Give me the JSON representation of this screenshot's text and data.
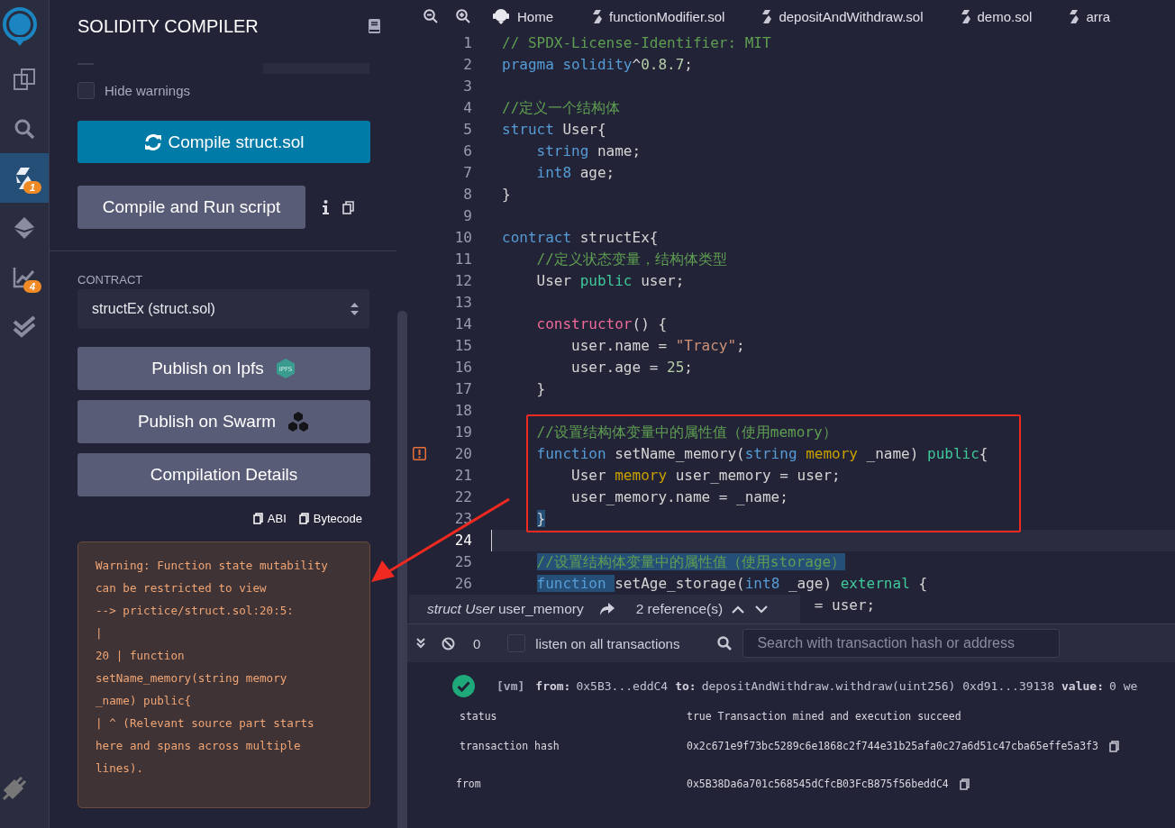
{
  "icon_bar": {
    "items": [
      {
        "kind": "logo",
        "selected": false
      },
      {
        "kind": "files",
        "selected": false
      },
      {
        "kind": "search",
        "selected": false
      },
      {
        "kind": "compiler",
        "selected": true,
        "badge": "1"
      },
      {
        "kind": "deploy",
        "selected": false
      },
      {
        "kind": "analysis",
        "selected": false,
        "badge": "4"
      },
      {
        "kind": "tests",
        "selected": false
      }
    ],
    "bottom_items": [
      {
        "kind": "plugins",
        "selected": false
      }
    ]
  },
  "panel": {
    "title": "SOLIDITY COMPILER",
    "hide_warnings": {
      "label": "Hide warnings",
      "checked": false
    },
    "compile_button": "Compile struct.sol",
    "run_button": "Compile and Run script",
    "contract": {
      "label": "CONTRACT",
      "value": "structEx (struct.sol)"
    },
    "actions": [
      {
        "label": "Publish on Ipfs",
        "kind": "ipfs",
        "badge": "IPFS"
      },
      {
        "label": "Publish on Swarm",
        "kind": "swarm"
      },
      {
        "label": "Compilation Details",
        "kind": "details"
      }
    ],
    "copy_links": [
      "ABI",
      "Bytecode"
    ],
    "warning": {
      "lines": [
        "Warning: Function state mutability",
        "can be restricted to view",
        "--> prictice/struct.sol:20:5:",
        "|",
        "20 | function",
        "setName_memory(string memory",
        "_name) public{",
        "| ^ (Relevant source part starts",
        "here and spans across multiple",
        "lines)."
      ]
    }
  },
  "editor": {
    "tabs": [
      {
        "label": "Home",
        "kind": "home"
      },
      {
        "label": "functionModifier.sol",
        "kind": "file"
      },
      {
        "label": "depositAndWithdraw.sol",
        "kind": "file"
      },
      {
        "label": "demo.sol",
        "kind": "file"
      },
      {
        "label": "arra",
        "kind": "file"
      }
    ],
    "lines": [
      {
        "number": "1",
        "active": false,
        "warning": false,
        "tokens": [
          {
            "kind": "comment",
            "t": "// SPDX-License-Identifier: MIT",
            "selected": false
          }
        ]
      },
      {
        "number": "2",
        "active": false,
        "warning": false,
        "tokens": [
          {
            "kind": "kw",
            "t": "pragma",
            "selected": false
          },
          {
            "kind": "kw",
            "t": " solidity",
            "selected": false
          },
          {
            "kind": "plain",
            "t": "^",
            "selected": false
          },
          {
            "kind": "num",
            "t": "0.8.7",
            "selected": false
          },
          {
            "kind": "plain",
            "t": ";",
            "selected": false
          }
        ]
      },
      {
        "number": "3",
        "active": false,
        "warning": false
      },
      {
        "number": "4",
        "active": false,
        "warning": false,
        "tokens": [
          {
            "kind": "comment",
            "t": "//定义一个结构体",
            "selected": false
          }
        ]
      },
      {
        "number": "5",
        "active": false,
        "warning": false,
        "tokens": [
          {
            "kind": "kw",
            "t": "struct",
            "selected": false
          },
          {
            "kind": "plain",
            "t": " User{",
            "selected": false
          }
        ]
      },
      {
        "number": "6",
        "active": false,
        "warning": false,
        "tokens": [
          {
            "kind": "kw",
            "t": "    string",
            "selected": false
          },
          {
            "kind": "plain",
            "t": " name;",
            "selected": false
          }
        ]
      },
      {
        "number": "7",
        "active": false,
        "warning": false,
        "tokens": [
          {
            "kind": "kw",
            "t": "    int8",
            "selected": false
          },
          {
            "kind": "plain",
            "t": " age;",
            "selected": false
          }
        ]
      },
      {
        "number": "8",
        "active": false,
        "warning": false,
        "tokens": [
          {
            "kind": "plain",
            "t": "}",
            "selected": false
          }
        ]
      },
      {
        "number": "9",
        "active": false,
        "warning": false
      },
      {
        "number": "10",
        "active": false,
        "warning": false,
        "tokens": [
          {
            "kind": "kw",
            "t": "contract",
            "selected": false
          },
          {
            "kind": "plain",
            "t": " structEx{",
            "selected": false
          }
        ]
      },
      {
        "number": "11",
        "active": false,
        "warning": false,
        "tokens": [
          {
            "kind": "comment",
            "t": "    //定义状态变量，结构体类型",
            "selected": false
          }
        ]
      },
      {
        "number": "12",
        "active": false,
        "warning": false,
        "tokens": [
          {
            "kind": "plain",
            "t": "    User ",
            "selected": false
          },
          {
            "kind": "mod",
            "t": "public",
            "selected": false
          },
          {
            "kind": "plain",
            "t": " user;",
            "selected": false
          }
        ]
      },
      {
        "number": "13",
        "active": false,
        "warning": false
      },
      {
        "number": "14",
        "active": false,
        "warning": false,
        "tokens": [
          {
            "kind": "ctor",
            "t": "    constructor",
            "selected": false
          },
          {
            "kind": "plain",
            "t": "() {",
            "selected": false
          }
        ]
      },
      {
        "number": "15",
        "active": false,
        "warning": false,
        "tokens": [
          {
            "kind": "plain",
            "t": "        user.name = ",
            "selected": false
          },
          {
            "kind": "str",
            "t": "\"Tracy\"",
            "selected": false
          },
          {
            "kind": "plain",
            "t": ";",
            "selected": false
          }
        ]
      },
      {
        "number": "16",
        "active": false,
        "warning": false,
        "tokens": [
          {
            "kind": "plain",
            "t": "        user.age = ",
            "selected": false
          },
          {
            "kind": "num",
            "t": "25",
            "selected": false
          },
          {
            "kind": "plain",
            "t": ";",
            "selected": false
          }
        ]
      },
      {
        "number": "17",
        "active": false,
        "warning": false,
        "tokens": [
          {
            "kind": "plain",
            "t": "    }",
            "selected": false
          }
        ]
      },
      {
        "number": "18",
        "active": false,
        "warning": false
      },
      {
        "number": "19",
        "active": false,
        "warning": false,
        "tokens": [
          {
            "kind": "comment",
            "t": "    //设置结构体变量中的属性值（使用memory）",
            "selected": false
          }
        ]
      },
      {
        "number": "20",
        "active": false,
        "warning": true,
        "tokens": [
          {
            "kind": "kw",
            "t": "    function",
            "selected": false
          },
          {
            "kind": "plain",
            "t": " setName_memory(",
            "selected": false
          },
          {
            "kind": "kw",
            "t": "string",
            "selected": false
          },
          {
            "kind": "loc",
            "t": " memory",
            "selected": false
          },
          {
            "kind": "plain",
            "t": " _name) ",
            "selected": false
          },
          {
            "kind": "mod",
            "t": "public",
            "selected": false
          },
          {
            "kind": "plain",
            "t": "{",
            "selected": false
          }
        ]
      },
      {
        "number": "21",
        "active": false,
        "warning": false,
        "tokens": [
          {
            "kind": "plain",
            "t": "        User ",
            "selected": false
          },
          {
            "kind": "loc",
            "t": "memory",
            "selected": false
          },
          {
            "kind": "plain",
            "t": " user_memory = user;",
            "selected": false
          }
        ]
      },
      {
        "number": "22",
        "active": false,
        "warning": false,
        "tokens": [
          {
            "kind": "plain",
            "t": "        user_memory.name = _name;",
            "selected": false
          }
        ]
      },
      {
        "number": "23",
        "active": false,
        "warning": false,
        "tokens": [
          {
            "kind": "plain",
            "t": "    }",
            "selected": true
          }
        ]
      },
      {
        "number": "24",
        "active": true,
        "warning": false
      },
      {
        "number": "25",
        "active": false,
        "warning": false,
        "tokens": [
          {
            "kind": "comment",
            "t": "    //设置结构体变量中的属性值（使用storage）",
            "selected": true
          }
        ]
      },
      {
        "number": "26",
        "active": false,
        "warning": false,
        "tokens": [
          {
            "kind": "kw",
            "t": "    function ",
            "selected": true
          },
          {
            "kind": "plain",
            "t": "setAge_storage(",
            "selected": false
          },
          {
            "kind": "kw",
            "t": "int8",
            "selected": false
          },
          {
            "kind": "plain",
            "t": " _age) ",
            "selected": false
          },
          {
            "kind": "mod",
            "t": "external",
            "selected": false
          },
          {
            "kind": "plain",
            "t": " {",
            "selected": false
          }
        ]
      },
      {
        "active": false,
        "warning": false,
        "tokens": [
          {
            "kind": "plain",
            "t": "                                    = user;",
            "selected": false
          }
        ]
      }
    ],
    "tooltip": {
      "type": "struct User",
      "name": "user_memory",
      "references": "2 reference(s)"
    }
  },
  "terminal": {
    "count": "0",
    "listen": {
      "label": "listen on all transactions",
      "checked": false
    },
    "search": {
      "placeholder": "Search with transaction hash or address"
    },
    "log": {
      "source": "[vm]",
      "parts": [
        {
          "key": "from:",
          "value": "0x5B3...eddC4"
        },
        {
          "key": "to:",
          "value": "depositAndWithdraw.withdraw(uint256) 0xd91...39138"
        },
        {
          "key": "value:",
          "value": "0 we"
        }
      ],
      "rows": [
        {
          "label": "status",
          "value": "true Transaction mined and execution succeed",
          "copy": false
        },
        {
          "label": "transaction hash",
          "value": "0x2c671e9f73bc5289c6e1868c2f744e31b25afa0c27a6d51c47cba65effe5a3f3",
          "copy": true
        },
        {
          "label": "from",
          "value": "0x5B38Da6a701c568545dCfcB03FcB875f56beddC4",
          "copy": true
        }
      ]
    }
  }
}
